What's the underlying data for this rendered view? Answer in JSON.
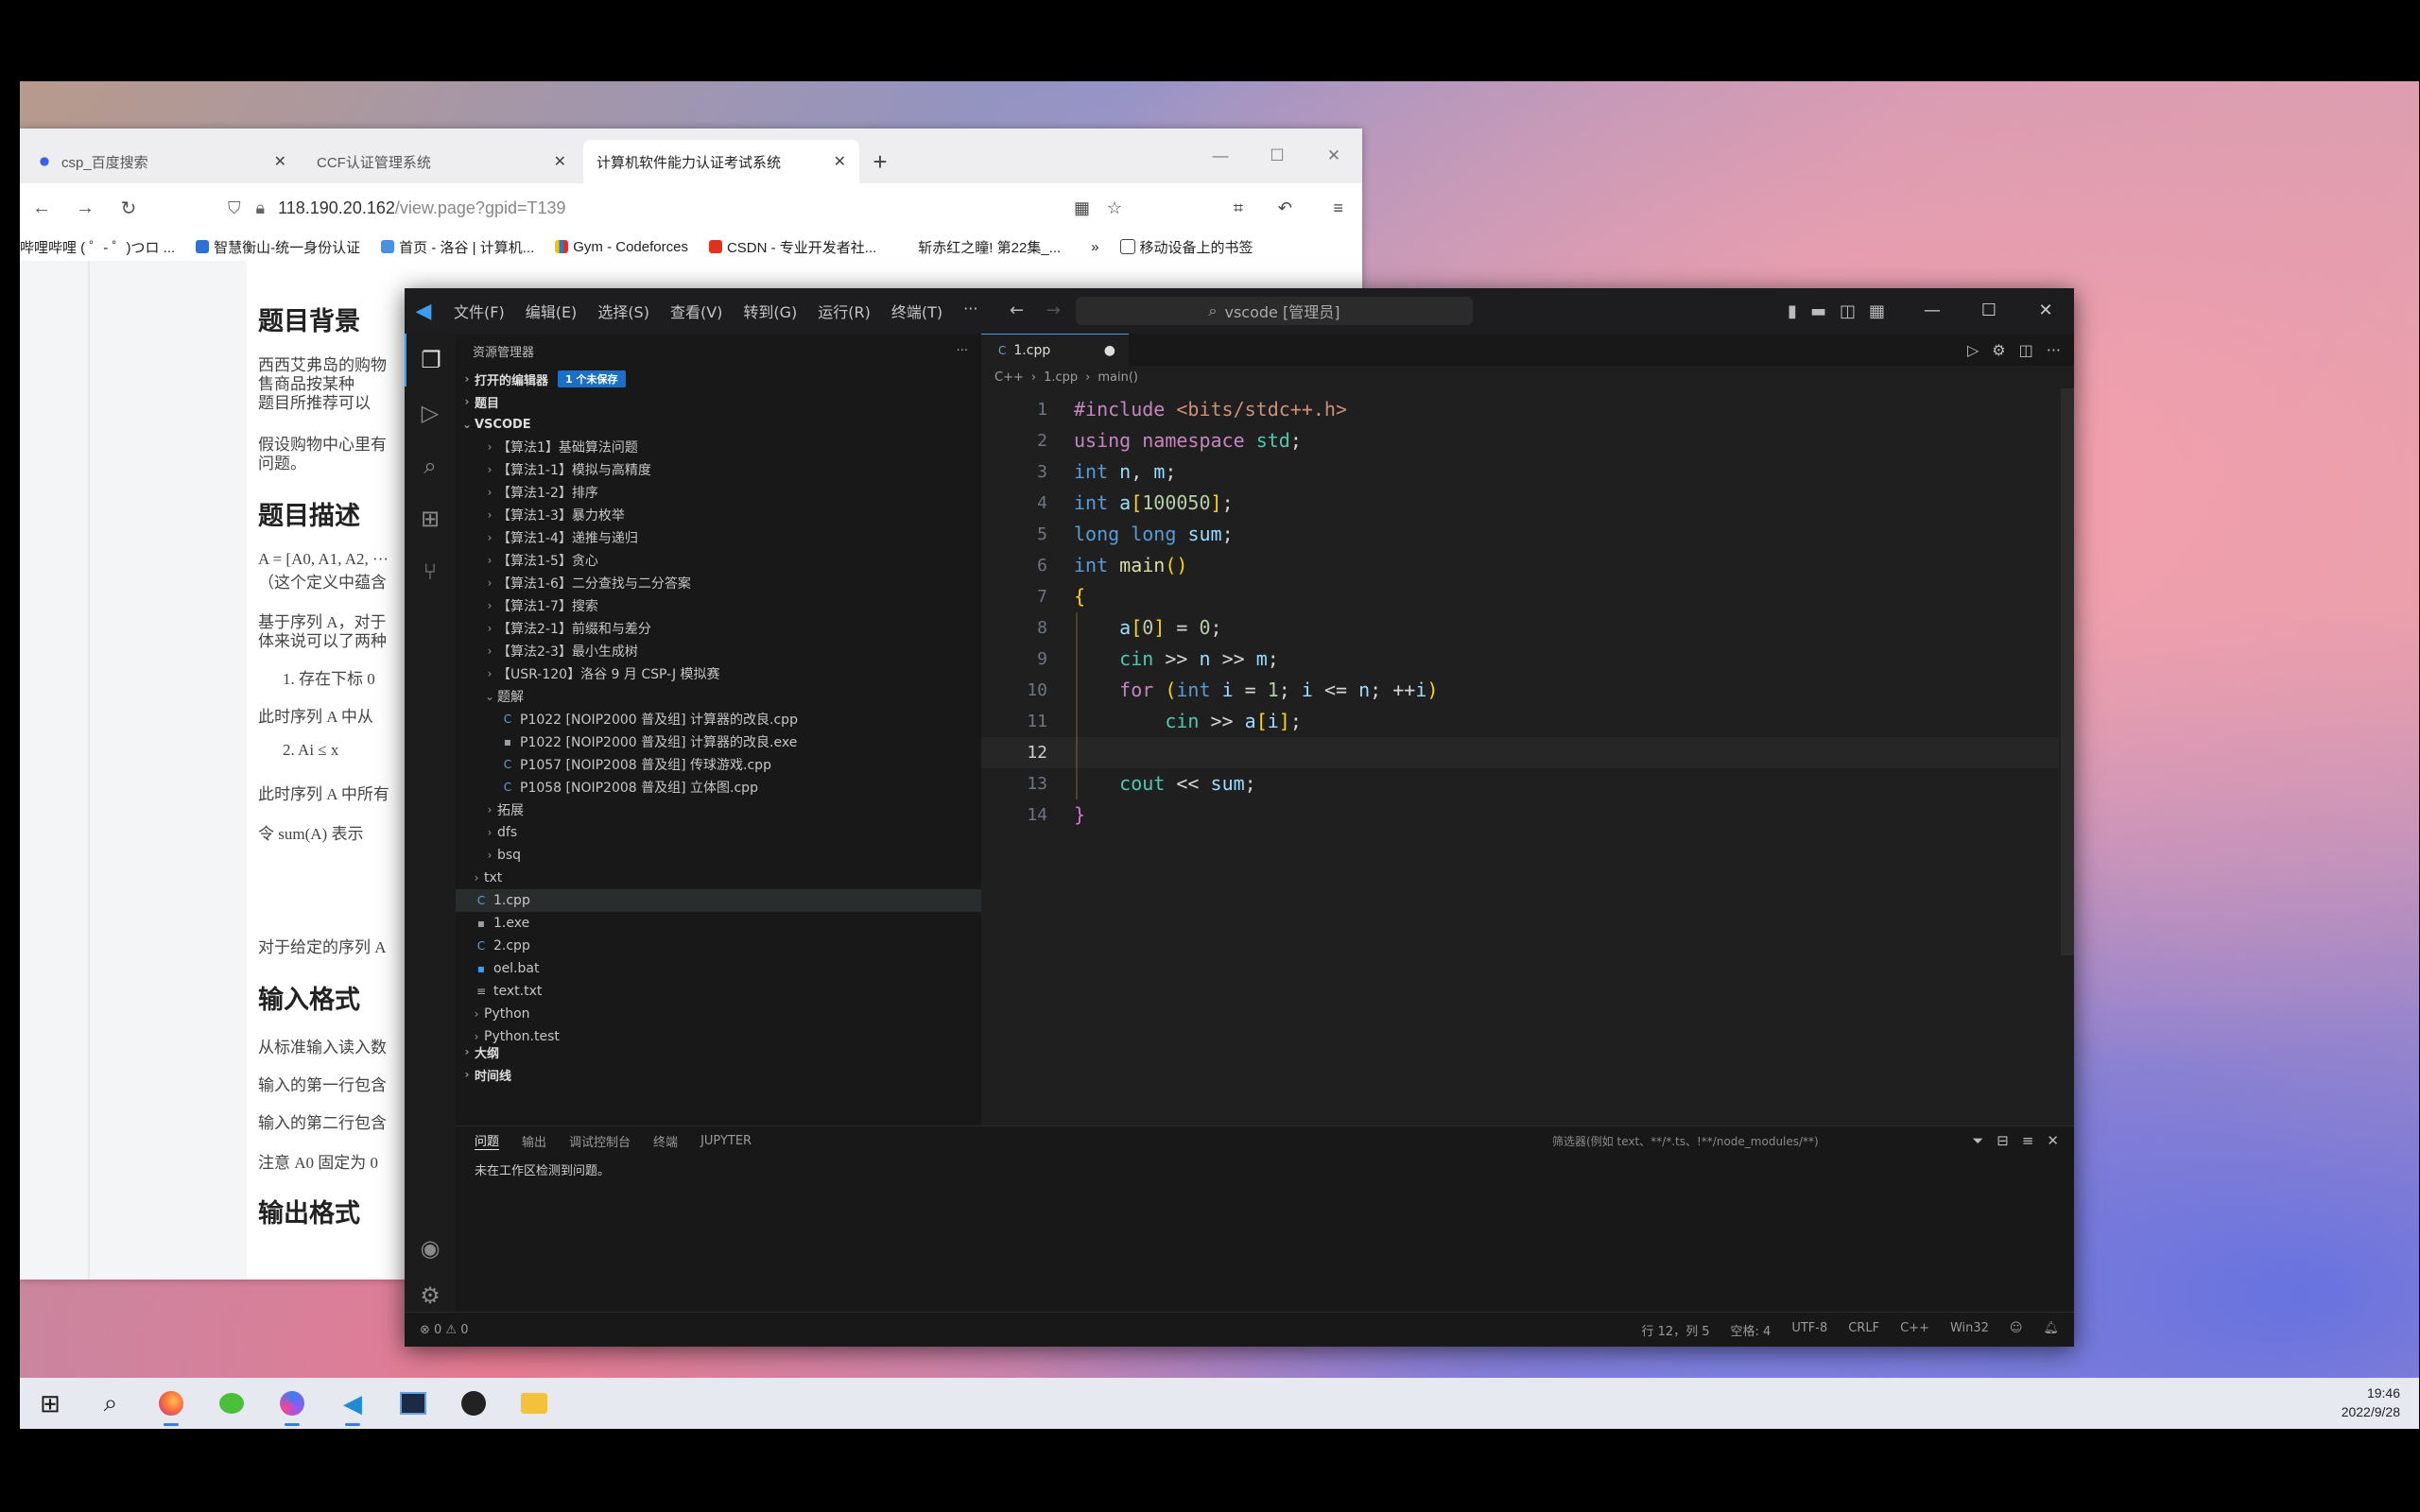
{
  "browser": {
    "tabs": [
      {
        "label": "csp_百度搜索"
      },
      {
        "label": "CCF认证管理系统"
      },
      {
        "label": "计算机软件能力认证考试系统"
      }
    ],
    "url_main": "118.190.20.162",
    "url_rest": "/view.page?gpid=T139",
    "bookmarks": [
      "哔哩哔哩 ( ゜- ゜)つロ ...",
      "智慧衡山-统一身份认证",
      "首页 - 洛谷 | 计算机...",
      "Gym - Codeforces",
      "CSDN - 专业开发者社...",
      "斩赤红之瞳! 第22集_..."
    ],
    "bookmarks_more": "移动设备上的书签",
    "page": {
      "h_background": "题目背景",
      "p_background_1": "西西艾弗岛的购物",
      "p_background_2": "售商品按某种",
      "p_background_3": "题目所推荐可以",
      "p_background_4": "假设购物中心里有",
      "p_background_5": "问题。",
      "h_desc": "题目描述",
      "p_desc_1": "A = [A0, A1, A2, ···",
      "p_desc_2": "（这个定义中蕴含",
      "p_desc_3": "基于序列 A，对于",
      "p_desc_4": "体来说可以了两种",
      "p_desc_5": "1.  存在下标 0",
      "p_desc_6": "此时序列 A 中从",
      "p_desc_7": "2.  Ai ≤ x",
      "p_desc_8": "此时序列 A 中所有",
      "p_desc_9": "令 sum(A) 表示",
      "p_desc_10": "对于给定的序列 A",
      "h_input": "输入格式",
      "p_input_1": "从标准输入读入数",
      "p_input_2": "输入的第一行包含",
      "p_input_3": "输入的第二行包含",
      "p_input_4": "注意 A0 固定为 0",
      "h_output": "输出格式"
    }
  },
  "vscode": {
    "menu": [
      "文件(F)",
      "编辑(E)",
      "选择(S)",
      "查看(V)",
      "转到(G)",
      "运行(R)",
      "终端(T)",
      "···"
    ],
    "search": "vscode [管理员]",
    "sidebar_title": "资源管理器",
    "sections": {
      "open_editors": "打开的编辑器",
      "open_editors_badge": "1 个未保存",
      "outline_top": "题目",
      "workspace": "VSCODE"
    },
    "tree": [
      {
        "label": "【算法1】基础算法问题",
        "indent": 1,
        "type": "folder"
      },
      {
        "label": "【算法1-1】模拟与高精度",
        "indent": 1,
        "type": "folder"
      },
      {
        "label": "【算法1-2】排序",
        "indent": 1,
        "type": "folder"
      },
      {
        "label": "【算法1-3】暴力枚举",
        "indent": 1,
        "type": "folder"
      },
      {
        "label": "【算法1-4】递推与递归",
        "indent": 1,
        "type": "folder"
      },
      {
        "label": "【算法1-5】贪心",
        "indent": 1,
        "type": "folder"
      },
      {
        "label": "【算法1-6】二分查找与二分答案",
        "indent": 1,
        "type": "folder"
      },
      {
        "label": "【算法1-7】搜索",
        "indent": 1,
        "type": "folder"
      },
      {
        "label": "【算法2-1】前缀和与差分",
        "indent": 1,
        "type": "folder"
      },
      {
        "label": "【算法2-3】最小生成树",
        "indent": 1,
        "type": "folder"
      },
      {
        "label": "【USR-120】洛谷 9 月 CSP-J 模拟赛",
        "indent": 1,
        "type": "folder"
      },
      {
        "label": "题解",
        "indent": 1,
        "type": "folder-open"
      },
      {
        "label": "P1022 [NOIP2000 普及组] 计算器的改良.cpp",
        "indent": 2,
        "type": "file-cpp"
      },
      {
        "label": "P1022 [NOIP2000 普及组] 计算器的改良.exe",
        "indent": 2,
        "type": "file-exe"
      },
      {
        "label": "P1057 [NOIP2008 普及组] 传球游戏.cpp",
        "indent": 2,
        "type": "file-cpp"
      },
      {
        "label": "P1058 [NOIP2008 普及组] 立体图.cpp",
        "indent": 2,
        "type": "file-cpp"
      },
      {
        "label": "拓展",
        "indent": 1,
        "type": "folder"
      },
      {
        "label": "dfs",
        "indent": 1,
        "type": "folder"
      },
      {
        "label": "bsq",
        "indent": 1,
        "type": "folder"
      },
      {
        "label": "txt",
        "indent": 0,
        "type": "folder"
      },
      {
        "label": "1.cpp",
        "indent": 0,
        "type": "file-cpp",
        "selected": true
      },
      {
        "label": "1.exe",
        "indent": 0,
        "type": "file-exe"
      },
      {
        "label": "2.cpp",
        "indent": 0,
        "type": "file-cpp"
      },
      {
        "label": "oel.bat",
        "indent": 0,
        "type": "file-bat"
      },
      {
        "label": "text.txt",
        "indent": 0,
        "type": "file-txt"
      },
      {
        "label": "Python",
        "indent": 0,
        "type": "folder"
      },
      {
        "label": "Python.test",
        "indent": 0,
        "type": "folder"
      }
    ],
    "sb_bottom": [
      "大纲",
      "时间线"
    ],
    "tab_label": "1.cpp",
    "breadcrumb": [
      "C++",
      "1.cpp",
      "main()"
    ],
    "code_lines": [
      {
        "n": "1",
        "text": "#include <bits/stdc++.h>"
      },
      {
        "n": "2",
        "text": "using namespace std;"
      },
      {
        "n": "3",
        "text": "int n, m;"
      },
      {
        "n": "4",
        "text": "int a[100050];"
      },
      {
        "n": "5",
        "text": "long long sum;"
      },
      {
        "n": "6",
        "text": "int main()"
      },
      {
        "n": "7",
        "text": "{"
      },
      {
        "n": "8",
        "text": "    a[0] = 0;"
      },
      {
        "n": "9",
        "text": "    cin >> n >> m;"
      },
      {
        "n": "10",
        "text": "    for (int i = 1; i <= n; ++i)"
      },
      {
        "n": "11",
        "text": "        cin >> a[i];"
      },
      {
        "n": "12",
        "text": ""
      },
      {
        "n": "13",
        "text": "    cout << sum;"
      },
      {
        "n": "14",
        "text": "}"
      }
    ],
    "current_line": "12",
    "panel": {
      "tabs": [
        "问题",
        "输出",
        "调试控制台",
        "终端",
        "JUPYTER"
      ],
      "filter": "筛选器(例如 text、**/*.ts、!**/node_modules/**)",
      "message": "未在工作区检测到问题。"
    },
    "status": {
      "left": "⊗ 0 ⚠ 0",
      "right": [
        "行 12，列 5",
        "空格: 4",
        "UTF-8",
        "CRLF",
        "C++",
        "Win32"
      ]
    }
  },
  "taskbar": {
    "time": "19:46",
    "date": "2022/9/28"
  }
}
